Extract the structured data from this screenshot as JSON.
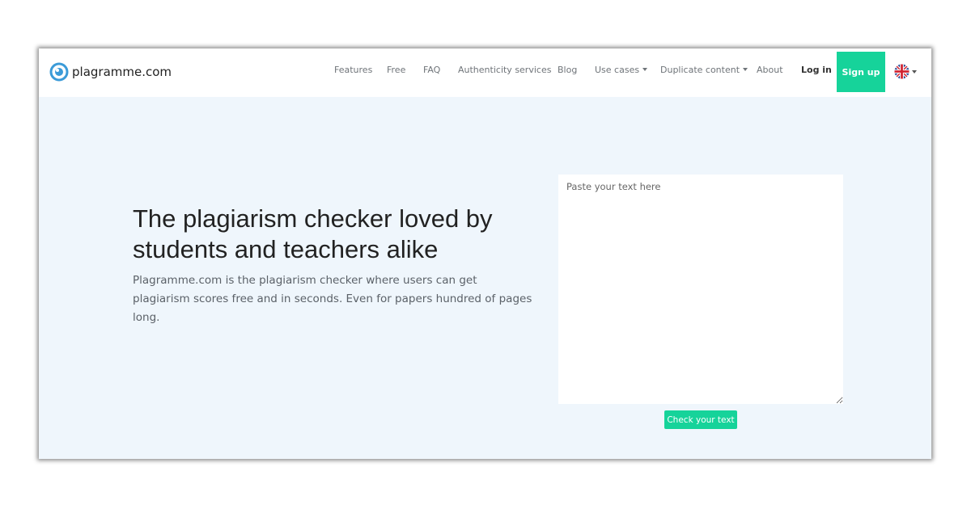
{
  "brand": {
    "name": "plagramme.com",
    "logo_icon": "eye-circle-icon"
  },
  "nav": {
    "features": "Features",
    "free": "Free",
    "faq": "FAQ",
    "authenticity": "Authenticity services",
    "blog": "Blog",
    "use_cases": "Use cases",
    "duplicate_content": "Duplicate content",
    "about": "About",
    "login": "Log in",
    "signup": "Sign up",
    "language_icon": "uk-flag-icon"
  },
  "hero": {
    "headline": "The plagiarism checker loved by students and teachers alike",
    "subtext": "Plagramme.com is the plagiarism checker where users can get plagiarism scores free and in seconds. Even for papers hundred of pages long."
  },
  "checker": {
    "input_value": "",
    "placeholder": "Paste your text here",
    "button": "Check your text"
  },
  "colors": {
    "accent": "#16d39a",
    "hero_background": "#eff6fc",
    "logo_blue": "#3b9bd8"
  }
}
